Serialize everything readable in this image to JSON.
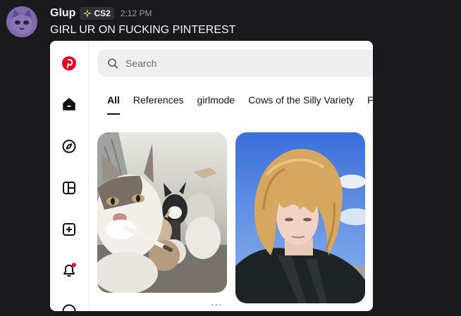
{
  "message": {
    "username": "Glup",
    "tag": "CS2",
    "timestamp": "2:12 PM",
    "text": "GIRL UR ON FUCKING PINTEREST"
  },
  "pinterest": {
    "search": {
      "placeholder": "Search",
      "value": ""
    },
    "tabs": [
      {
        "label": "All",
        "active": true
      },
      {
        "label": "References",
        "active": false
      },
      {
        "label": "girlmode",
        "active": false
      },
      {
        "label": "Cows of the Silly Variety",
        "active": false
      },
      {
        "label": "Fu",
        "active": false
      }
    ],
    "sidebar_icons": [
      "pinterest-logo-icon",
      "home-icon",
      "explore-icon",
      "boards-icon",
      "create-icon",
      "notifications-icon",
      "messages-icon"
    ],
    "pins": [
      {
        "description": "cats-with-cigarette"
      },
      {
        "description": "person-with-blonde-hair"
      }
    ],
    "more_indicator": "···"
  },
  "colors": {
    "background": "#1a1a1e",
    "pinterest_red": "#e60023",
    "tag_bg": "#2f3037"
  }
}
